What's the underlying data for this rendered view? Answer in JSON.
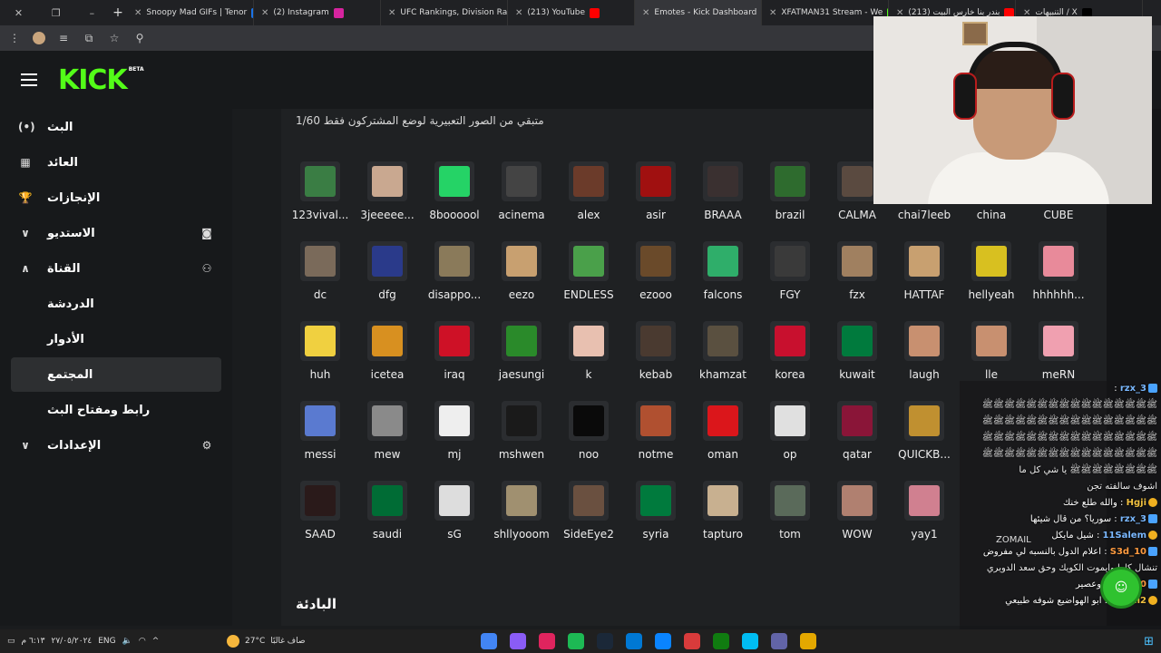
{
  "browser": {
    "tabs": [
      {
        "title": "Snoopy Mad GIFs | Tenor",
        "favicon_color": "#1a73e8"
      },
      {
        "title": "(2) Instagram",
        "favicon_color": "#d6249f"
      },
      {
        "title": "UFC Rankings, Division Ra",
        "favicon_color": "#cccccc"
      },
      {
        "title": "(213) YouTube",
        "favicon_color": "#ff0000"
      },
      {
        "title": "Emotes - Kick Dashboard",
        "favicon_color": "#53fc18",
        "active": true
      },
      {
        "title": "XFATMAN31 Stream - We",
        "favicon_color": "#53fc18"
      },
      {
        "title": "(213) بندر بنا خارس البيت",
        "favicon_color": "#ff0000"
      },
      {
        "title": "التنبيهات / X",
        "favicon_color": "#000000"
      }
    ]
  },
  "kick": {
    "logo": "KICK",
    "logo_badge": "BETA",
    "accent": "#53fc18"
  },
  "sidebar": {
    "items": [
      {
        "label": "البث",
        "icon": "(•)",
        "sub": false
      },
      {
        "label": "العائد",
        "icon": "▦",
        "sub": false
      },
      {
        "label": "الإنجازات",
        "icon": "🏆",
        "sub": false
      },
      {
        "label": "الاستديو",
        "icon": "◙",
        "chevron": "∨",
        "sub": false
      },
      {
        "label": "القناة",
        "icon": "⚇",
        "chevron": "∧",
        "sub": false
      },
      {
        "label": "الدردشة",
        "sub": true
      },
      {
        "label": "الأدوار",
        "sub": true
      },
      {
        "label": "المجتمع",
        "sub": true,
        "active": true
      },
      {
        "label": "رابط ومفتاح البث",
        "sub": true
      },
      {
        "label": "الإعدادات",
        "icon": "⚙",
        "chevron": "∨",
        "sub": false
      }
    ]
  },
  "main": {
    "subtitle": "متبقي من الصور التعبيرية لوضع المشتركون فقط 1/60",
    "section_title": "البادئة",
    "emotes": [
      [
        "123vival...",
        "3jeeeee...",
        "8boooool",
        "acinema",
        "alex",
        "asir",
        "BRAAA",
        "brazil",
        "CALMA",
        "chai7leeb",
        "china",
        "CUBE"
      ],
      [
        "dc",
        "dfg",
        "disappo...",
        "eezo",
        "ENDLESS",
        "ezooo",
        "falcons",
        "FGY",
        "fzx",
        "HATTAF",
        "hellyeah",
        "hhhhhh..."
      ],
      [
        "huh",
        "icetea",
        "iraq",
        "jaesungi",
        "k",
        "kebab",
        "khamzat",
        "korea",
        "kuwait",
        "laugh",
        "lle",
        "meRN"
      ],
      [
        "messi",
        "mew",
        "mj",
        "mshwen",
        "noo",
        "notme",
        "oman",
        "op",
        "qatar",
        "QUICKB...",
        "",
        ""
      ],
      [
        "SAAD",
        "saudi",
        "sG",
        "shllyooom",
        "SideEye2",
        "syria",
        "tapturo",
        "tom",
        "WOW",
        "yay1",
        "",
        ""
      ]
    ],
    "emote_colors": [
      [
        "#3a7d44",
        "#c9a890",
        "#25d366",
        "#444444",
        "#6b3b2a",
        "#a01010",
        "#3a3030",
        "#2e6b2e",
        "#5a4a40",
        "#4a3a30",
        "#de2910",
        "#3b4fa8"
      ],
      [
        "#7a6a5a",
        "#2a3a8a",
        "#8a7a5a",
        "#c8a070",
        "#4aa04a",
        "#6a4a2a",
        "#2fae6a",
        "#3a3a3a",
        "#a08060",
        "#c8a070",
        "#d8c020",
        "#e88a9a"
      ],
      [
        "#f0d040",
        "#d89020",
        "#ce1126",
        "#2a8a2a",
        "#e8c0b0",
        "#4a3a30",
        "#5a5040",
        "#c8102e",
        "#007a3d",
        "#c89070",
        "#c89070",
        "#f0a0b0"
      ],
      [
        "#5a7ad0",
        "#8a8a8a",
        "#eeeeee",
        "#1a1a1a",
        "#0a0a0a",
        "#b05030",
        "#db161b",
        "#e0e0e0",
        "#8a1538",
        "#c09030",
        "",
        ""
      ],
      [
        "#2a1a1a",
        "#006c35",
        "#dddddd",
        "#a09070",
        "#6a5040",
        "#007a3d",
        "#c8b090",
        "#5a6a5a",
        "#b08070",
        "#d08090",
        "",
        ""
      ]
    ]
  },
  "chat": {
    "lines": [
      {
        "user": "rzx_3",
        "text": ":"
      },
      {
        "user": "",
        "text": "ﷺﷺﷺﷺﷺﷺﷺﷺﷺﷺﷺﷺﷺﷺﷺﷺ"
      },
      {
        "user": "",
        "text": "ﷺﷺﷺﷺﷺﷺﷺﷺﷺﷺﷺﷺﷺﷺﷺﷺ"
      },
      {
        "user": "",
        "text": "ﷺﷺﷺﷺﷺﷺﷺﷺﷺﷺﷺﷺﷺﷺﷺﷺ"
      },
      {
        "user": "",
        "text": "ﷺﷺﷺﷺﷺﷺﷺﷺﷺﷺﷺﷺﷺﷺﷺﷺ"
      },
      {
        "user": "",
        "text": "ﷺﷺﷺﷺﷺﷺﷺﷺ يا شي كل ما"
      },
      {
        "user": "",
        "text": "اشوف سالفته تجن"
      },
      {
        "user": "Hgji",
        "text": ": والله طلع خنك"
      },
      {
        "user": "rzx_3",
        "text": ": سوريا؟ من قال شيئها"
      },
      {
        "user": "11Salem",
        "text": ": شيل مايكل"
      },
      {
        "user": "S3d_10",
        "text": ": اعلام الدول بالنسبه لي مفروض"
      },
      {
        "user": "",
        "text": "تنشال كلها وايموت الكويك وحق سعد الدويري"
      },
      {
        "user": "S3d_10",
        "text": ": وعصير"
      },
      {
        "user": "Mawli2",
        "text": ": ابو الهواضيع شوفه طبيعي"
      }
    ],
    "overlay_label": "ZOMAIL"
  },
  "taskbar": {
    "time": "٦:١٣ م",
    "date": "٢٧/٠٥/٢٠٢٤",
    "lang": "ENG",
    "temp": "27°C",
    "weather_text": "صاف غالبًا",
    "apps": [
      "#4285f4",
      "#8a5cf6",
      "#e0245e",
      "#1db954",
      "#1b2838",
      "#0078d4",
      "#0a84ff",
      "#d93b3b",
      "#107c10",
      "#00bcf2",
      "#6264a7",
      "#e4a800"
    ]
  }
}
